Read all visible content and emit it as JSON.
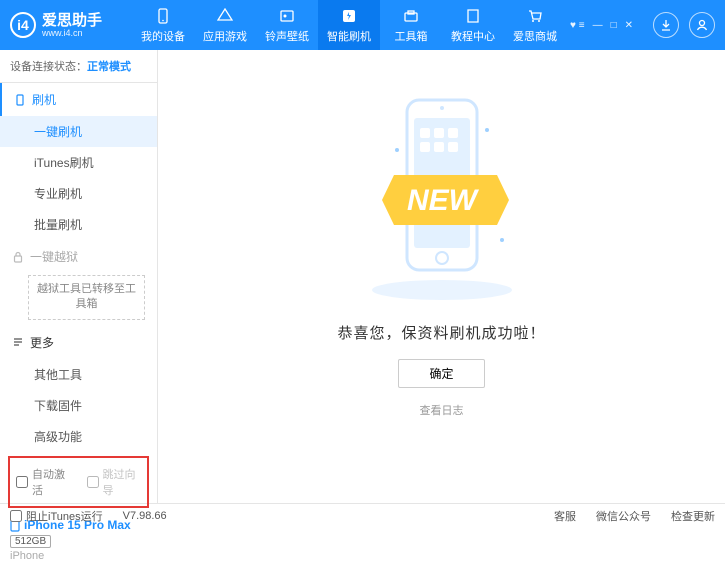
{
  "app": {
    "name": "爱思助手",
    "site": "www.i4.cn"
  },
  "nav": {
    "items": [
      {
        "label": "我的设备"
      },
      {
        "label": "应用游戏"
      },
      {
        "label": "铃声壁纸"
      },
      {
        "label": "智能刷机"
      },
      {
        "label": "工具箱"
      },
      {
        "label": "教程中心"
      },
      {
        "label": "爱思商城"
      }
    ],
    "active_index": 3
  },
  "sidebar": {
    "status_label": "设备连接状态：",
    "status_value": "正常模式",
    "flash": {
      "head": "刷机",
      "items": [
        "一键刷机",
        "iTunes刷机",
        "专业刷机",
        "批量刷机"
      ],
      "active_index": 0
    },
    "jailbreak": {
      "head": "一键越狱",
      "note": "越狱工具已转移至工具箱"
    },
    "more": {
      "head": "更多",
      "items": [
        "其他工具",
        "下载固件",
        "高级功能"
      ]
    },
    "options": {
      "auto_activate": "自动激活",
      "skip_guide": "跳过向导"
    },
    "device": {
      "name": "iPhone 15 Pro Max",
      "storage": "512GB",
      "type": "iPhone"
    }
  },
  "main": {
    "badge": "NEW",
    "success_text": "恭喜您，保资料刷机成功啦！",
    "ok_label": "确定",
    "view_log": "查看日志"
  },
  "statusbar": {
    "block_itunes": "阻止iTunes运行",
    "version": "V7.98.66",
    "service": "客服",
    "wechat": "微信公众号",
    "update": "检查更新"
  }
}
